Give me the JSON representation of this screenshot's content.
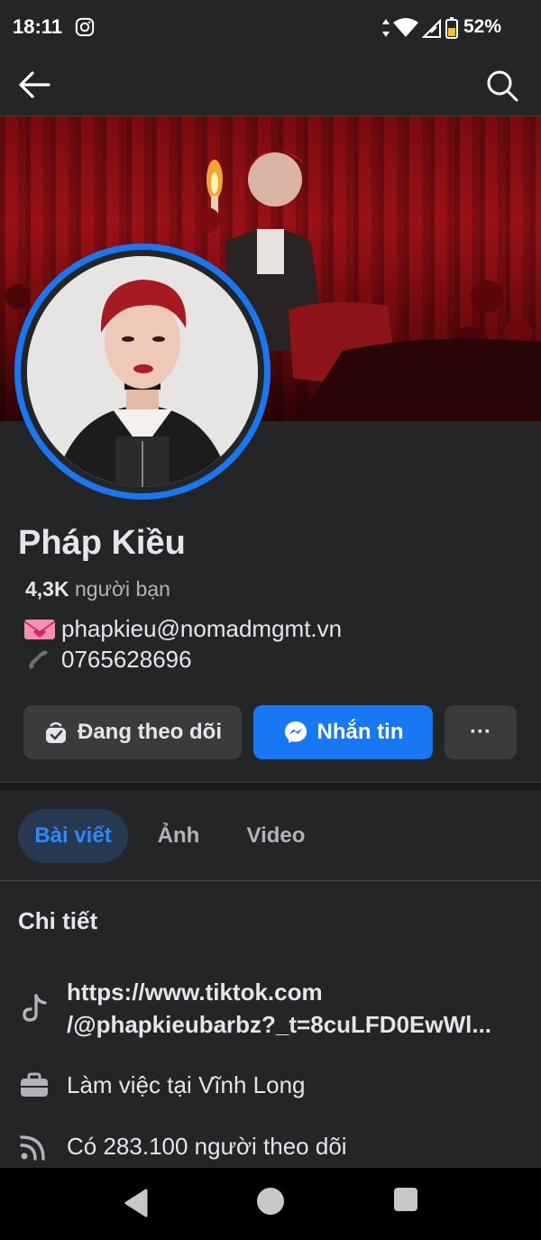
{
  "status_bar": {
    "time": "18:11",
    "battery_percent": "52%",
    "icons": [
      "instagram-icon",
      "data-arrows-icon",
      "wifi-icon",
      "signal-icon",
      "battery-icon"
    ]
  },
  "topnav": {
    "icons": [
      "back-arrow-icon",
      "search-icon"
    ]
  },
  "profile": {
    "name": "Pháp Kiều",
    "friends_count": "4,3K",
    "friends_label": "người bạn",
    "email": "phapkieu@nomadmgmt.vn",
    "phone": "0765628696"
  },
  "actions": {
    "follow_label": "Đang theo dõi",
    "message_label": "Nhắn tin",
    "more_label": "···"
  },
  "tabs": [
    {
      "label": "Bài viết",
      "active": true
    },
    {
      "label": "Ảnh",
      "active": false
    },
    {
      "label": "Video",
      "active": false
    }
  ],
  "details": {
    "title": "Chi tiết",
    "link_line1": "https://www.tiktok.com",
    "link_line2": "/@phapkieubarbz?_t=8cuLFD0EwWl...",
    "work": "Làm việc tại Vĩnh Long",
    "followers": "Có 283.100 người theo dõi"
  },
  "colors": {
    "background": "#242526",
    "accent": "#1877f2",
    "active_tab_bg": "#263951",
    "button_gray": "#3a3b3c"
  }
}
